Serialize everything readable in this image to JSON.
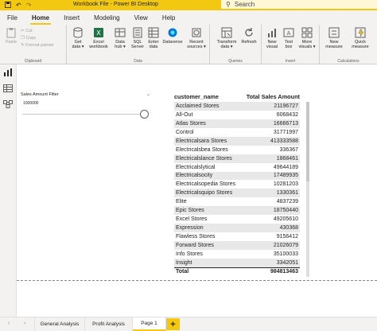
{
  "window": {
    "title": "Workbook File - Power BI Desktop",
    "search_placeholder": "Search",
    "icons": [
      "save-icon",
      "undo-icon",
      "redo-icon"
    ]
  },
  "menu": {
    "tabs": [
      "File",
      "Home",
      "Insert",
      "Modeling",
      "View",
      "Help"
    ],
    "active": "Home"
  },
  "ribbon": {
    "clipboard": {
      "label": "Clipboard",
      "paste": "Paste",
      "cut": "Cut",
      "copy": "Copy",
      "format_painter": "Format painter"
    },
    "data": {
      "label": "Data",
      "get_data": [
        "Get",
        "data ▾"
      ],
      "excel": [
        "Excel",
        "workbook"
      ],
      "data_hub": [
        "Data",
        "hub ▾"
      ],
      "sql": [
        "SQL",
        "Server"
      ],
      "enter_data": [
        "Enter",
        "data"
      ],
      "dataverse": [
        "Dataverse",
        ""
      ],
      "recent_sources": [
        "Recent",
        "sources ▾"
      ]
    },
    "queries": {
      "label": "Queries",
      "transform": [
        "Transform",
        "data ▾"
      ],
      "refresh": [
        "Refresh",
        ""
      ]
    },
    "insert": {
      "label": "Insert",
      "new_visual": [
        "New",
        "visual"
      ],
      "text_box": [
        "Text",
        "box"
      ],
      "more_visuals": [
        "More",
        "visuals ▾"
      ]
    },
    "calculations": {
      "label": "Calculations",
      "new_measure": [
        "New",
        "measure"
      ],
      "quick_measure": [
        "Quick",
        "measure"
      ]
    }
  },
  "slicer": {
    "title": "Sales Amount Filter",
    "value": "1000000",
    "level": 1.0
  },
  "table": {
    "headers": [
      "customer_name",
      "Total Sales Amount"
    ],
    "rows": [
      [
        "Acclaimed Stores",
        "21196727"
      ],
      [
        "All-Out",
        "6068432"
      ],
      [
        "Atlas Stores",
        "16666713"
      ],
      [
        "Control",
        "31771997"
      ],
      [
        "Electricalsara Stores",
        "413333588"
      ],
      [
        "Electricalsbea Stores",
        "336367"
      ],
      [
        "Electricalslance Stores",
        "1868461"
      ],
      [
        "Electricalslytical",
        "49644189"
      ],
      [
        "Electricalsocity",
        "17489935"
      ],
      [
        "Electricalsopedia Stores",
        "10281203"
      ],
      [
        "Electricalsquipo Stores",
        "1330361"
      ],
      [
        "Elite",
        "4837239"
      ],
      [
        "Epic Stores",
        "18750440"
      ],
      [
        "Excel Stores",
        "49205610"
      ],
      [
        "Expression",
        "430368"
      ],
      [
        "Flawless Stores",
        "9156412"
      ],
      [
        "Forward Stores",
        "21026079"
      ],
      [
        "Info Stores",
        "35100033"
      ],
      [
        "Insight",
        "3342051"
      ]
    ],
    "total_label": "Total",
    "total_value": "984813463"
  },
  "pages": {
    "tabs": [
      "General Analysis",
      "Profit Analysis",
      "Page 1"
    ],
    "active": "Page 1",
    "add": "+"
  },
  "colors": {
    "accent": "#f2c811",
    "ribbon_bg": "#f3f2f1",
    "row_stripe": "#e8e8e8"
  }
}
